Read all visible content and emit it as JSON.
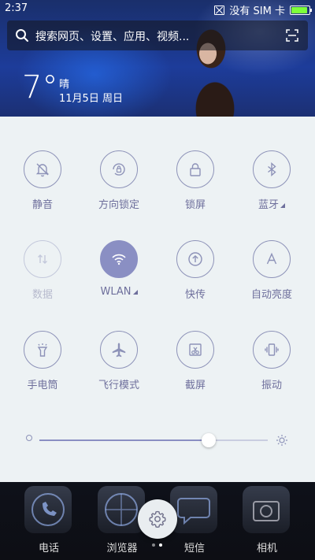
{
  "status_bar": {
    "time": "2:37",
    "sim_text": "没有 SIM 卡"
  },
  "search": {
    "placeholder": "搜索网页、设置、应用、视频..."
  },
  "weather": {
    "temperature": "7°",
    "condition": "晴",
    "date": "11月5日 周日"
  },
  "toggles": [
    {
      "label": "静音",
      "icon": "bell-off-icon",
      "state": "off"
    },
    {
      "label": "方向锁定",
      "icon": "rotation-lock-icon",
      "state": "off"
    },
    {
      "label": "锁屏",
      "icon": "lock-icon",
      "state": "off"
    },
    {
      "label": "蓝牙",
      "icon": "bluetooth-icon",
      "state": "off"
    },
    {
      "label": "数据",
      "icon": "mobile-data-icon",
      "state": "disabled"
    },
    {
      "label": "WLAN",
      "icon": "wifi-icon",
      "state": "on"
    },
    {
      "label": "快传",
      "icon": "upload-icon",
      "state": "off"
    },
    {
      "label": "自动亮度",
      "icon": "auto-brightness-icon",
      "state": "off"
    },
    {
      "label": "手电筒",
      "icon": "flashlight-icon",
      "state": "off"
    },
    {
      "label": "飞行模式",
      "icon": "airplane-icon",
      "state": "off"
    },
    {
      "label": "截屏",
      "icon": "screenshot-icon",
      "state": "off"
    },
    {
      "label": "振动",
      "icon": "vibrate-icon",
      "state": "off"
    }
  ],
  "brightness": {
    "level": 0.74
  },
  "dock": [
    {
      "label": "电话",
      "icon": "phone-icon"
    },
    {
      "label": "浏览器",
      "icon": "browser-icon"
    },
    {
      "label": "短信",
      "icon": "message-icon"
    },
    {
      "label": "相机",
      "icon": "camera-icon"
    }
  ],
  "colors": {
    "accent": "#8a8fc3",
    "panel_bg": "#edf2f4",
    "label": "#6e6f9c"
  }
}
